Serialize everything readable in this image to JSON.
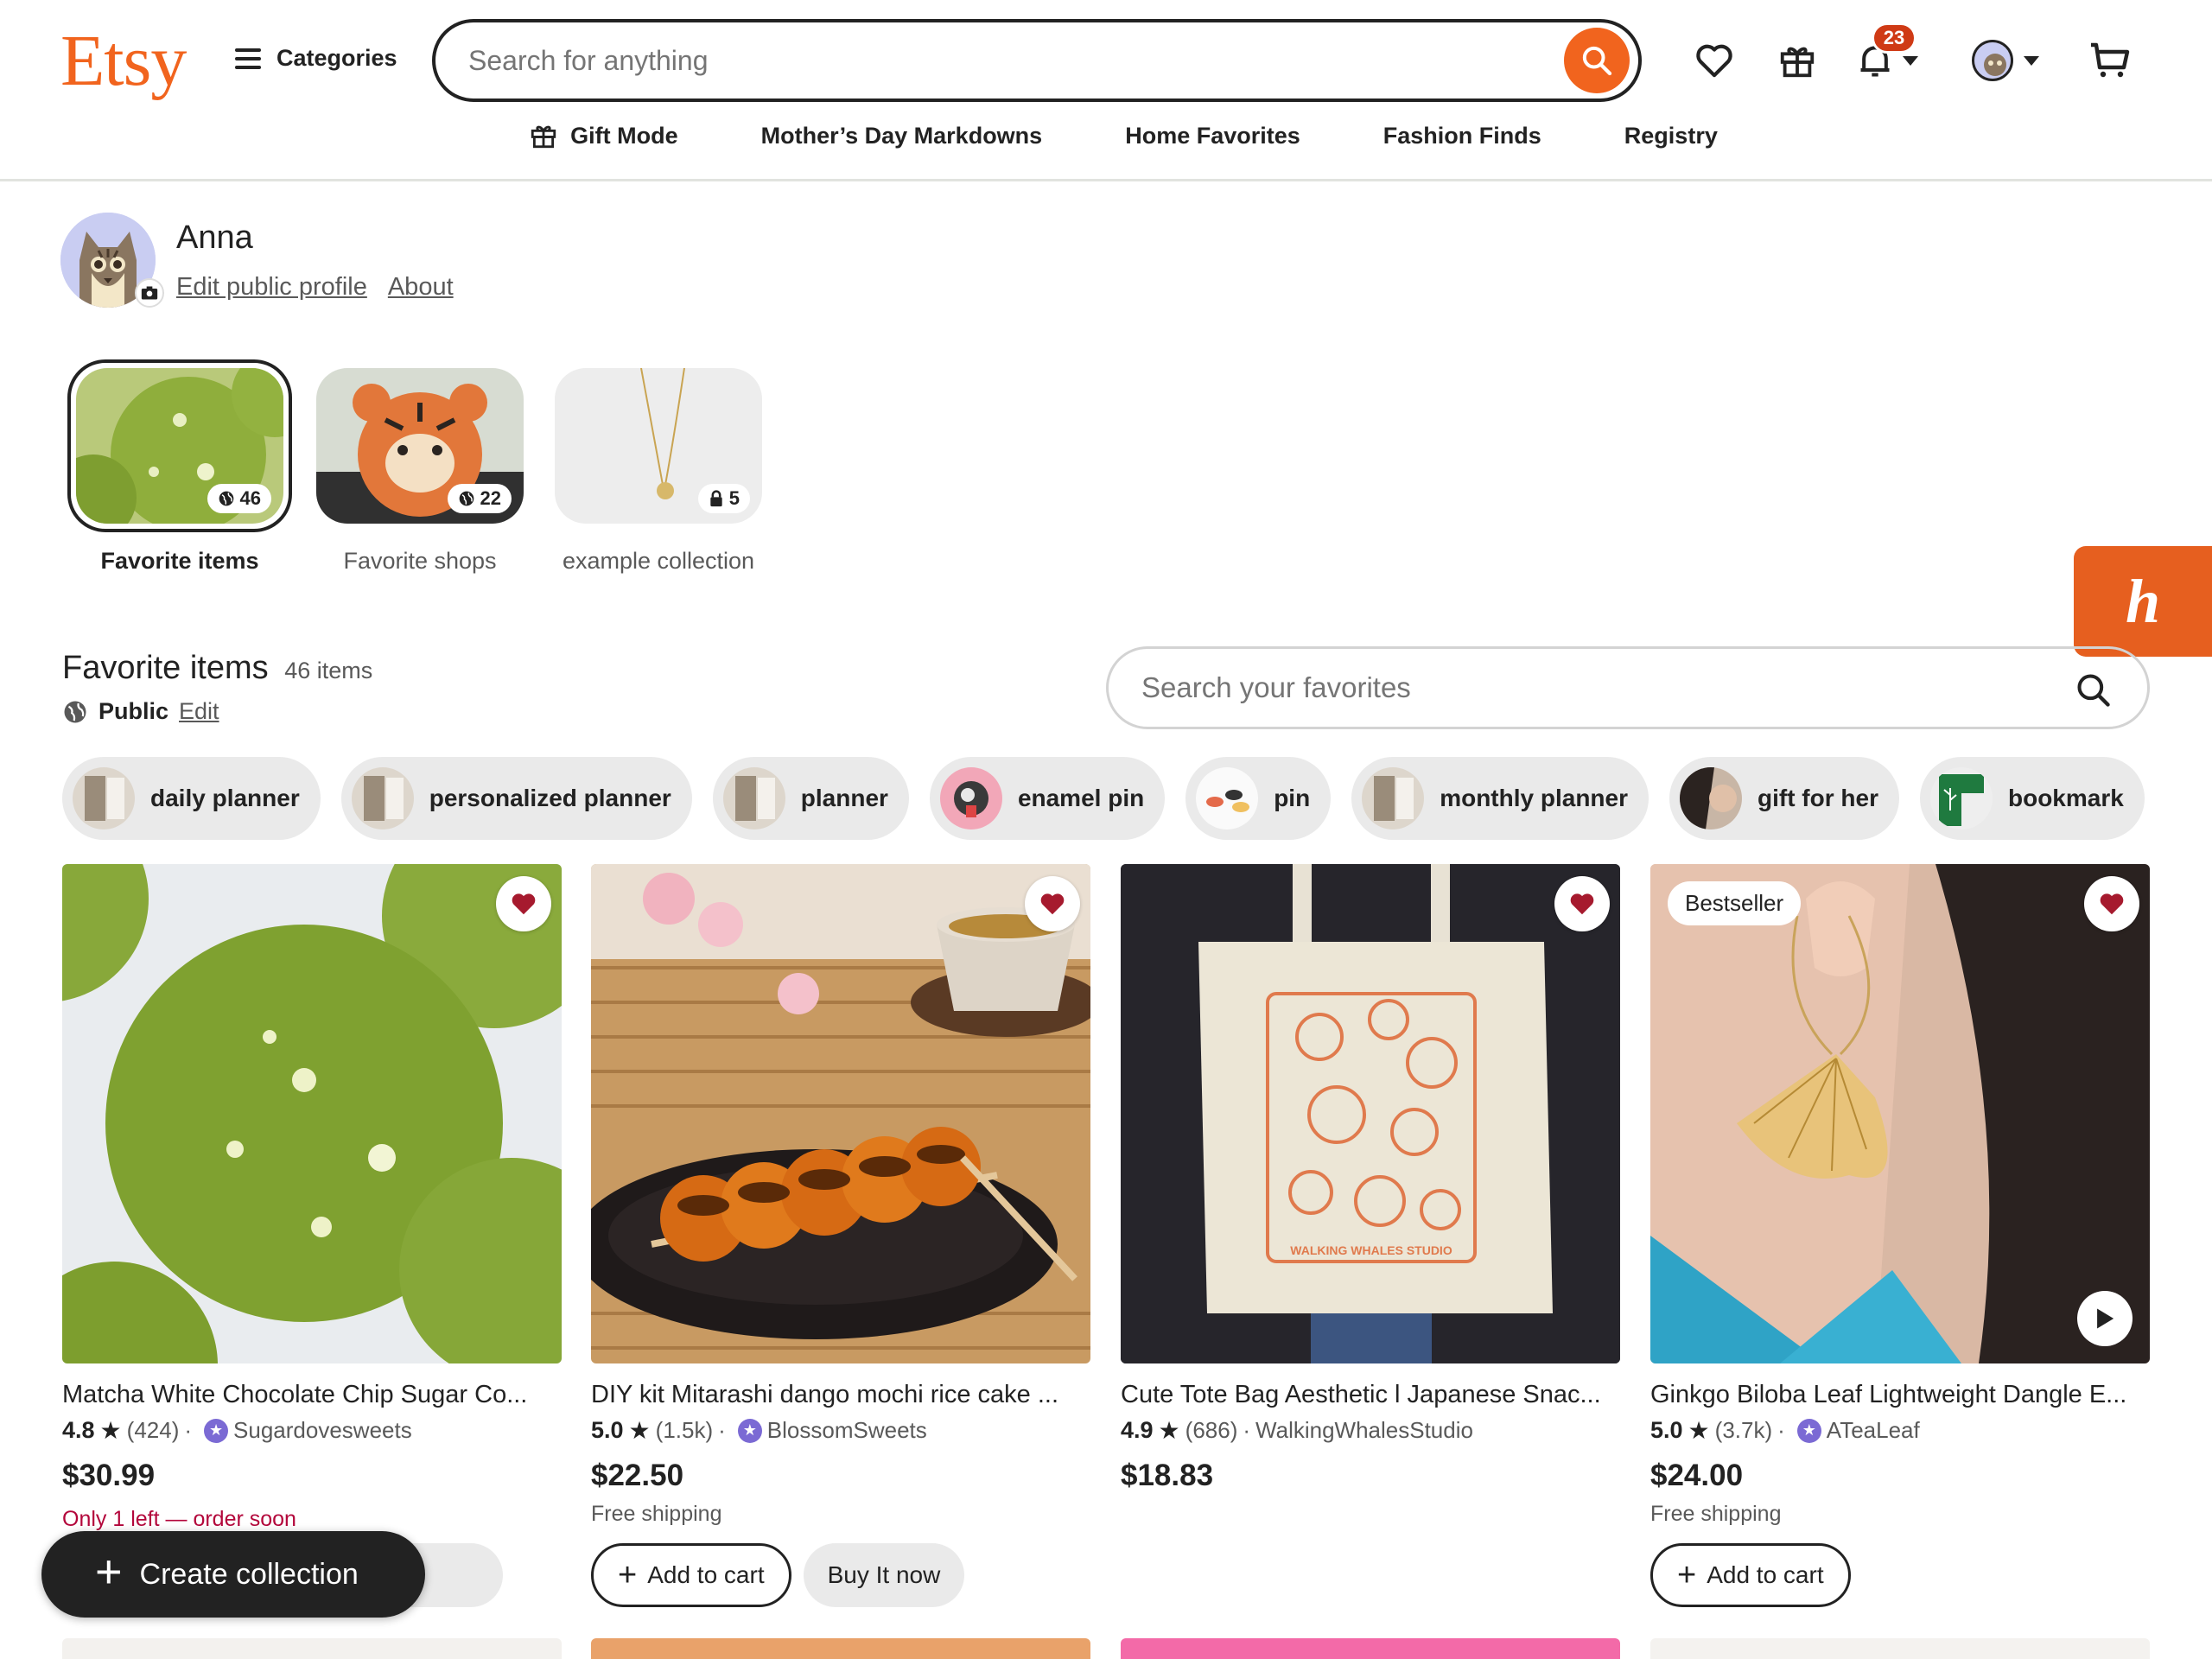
{
  "header": {
    "logo": "Etsy",
    "categories_label": "Categories",
    "search_placeholder": "Search for anything",
    "notifications_count": "23"
  },
  "nav": {
    "items": [
      "Gift Mode",
      "Mother’s Day Markdowns",
      "Home Favorites",
      "Fashion Finds",
      "Registry"
    ]
  },
  "profile": {
    "name": "Anna",
    "edit_link": "Edit public profile",
    "about_link": "About"
  },
  "collections": [
    {
      "label": "Favorite items",
      "count": "46",
      "privacy": "public",
      "active": true
    },
    {
      "label": "Favorite shops",
      "count": "22",
      "privacy": "public",
      "active": false
    },
    {
      "label": "example collection",
      "count": "5",
      "privacy": "private",
      "active": false
    }
  ],
  "favorites": {
    "title": "Favorite items",
    "count_text": "46 items",
    "visibility": "Public",
    "edit_label": "Edit",
    "search_placeholder": "Search your favorites"
  },
  "chips": [
    "daily planner",
    "personalized planner",
    "planner",
    "enamel pin",
    "pin",
    "monthly planner",
    "gift for her",
    "bookmark"
  ],
  "cards": [
    {
      "title": "Matcha White Chocolate Chip Sugar Co...",
      "rating": "4.8",
      "reviews": "(424)",
      "shop": "Sugardovesweets",
      "star_seller": true,
      "price": "$30.99",
      "note": "Only 1 left — order soon",
      "shipping": ""
    },
    {
      "title": "DIY kit Mitarashi dango mochi rice cake ...",
      "rating": "5.0",
      "reviews": "(1.5k)",
      "shop": "BlossomSweets",
      "star_seller": true,
      "price": "$22.50",
      "note": "",
      "shipping": "Free shipping"
    },
    {
      "title": "Cute Tote Bag Aesthetic l Japanese Snac...",
      "rating": "4.9",
      "reviews": "(686)",
      "shop": "WalkingWhalesStudio",
      "star_seller": false,
      "price": "$18.83",
      "note": "",
      "shipping": "",
      "tote_text": "WALKING WHALES STUDIO"
    },
    {
      "title": "Ginkgo Biloba Leaf Lightweight Dangle E...",
      "rating": "5.0",
      "reviews": "(3.7k)",
      "shop": "ATeaLeaf",
      "star_seller": true,
      "price": "$24.00",
      "note": "",
      "shipping": "Free shipping",
      "badge": "Bestseller"
    }
  ],
  "buttons": {
    "add_to_cart": "Add to cart",
    "buy_it_now": "Buy It now",
    "create_collection": "Create collection"
  },
  "colors": {
    "brand": "#f1641e",
    "heart": "#a61a2e",
    "low_stock": "#b3063b",
    "star_seller": "#7b6ad4"
  }
}
